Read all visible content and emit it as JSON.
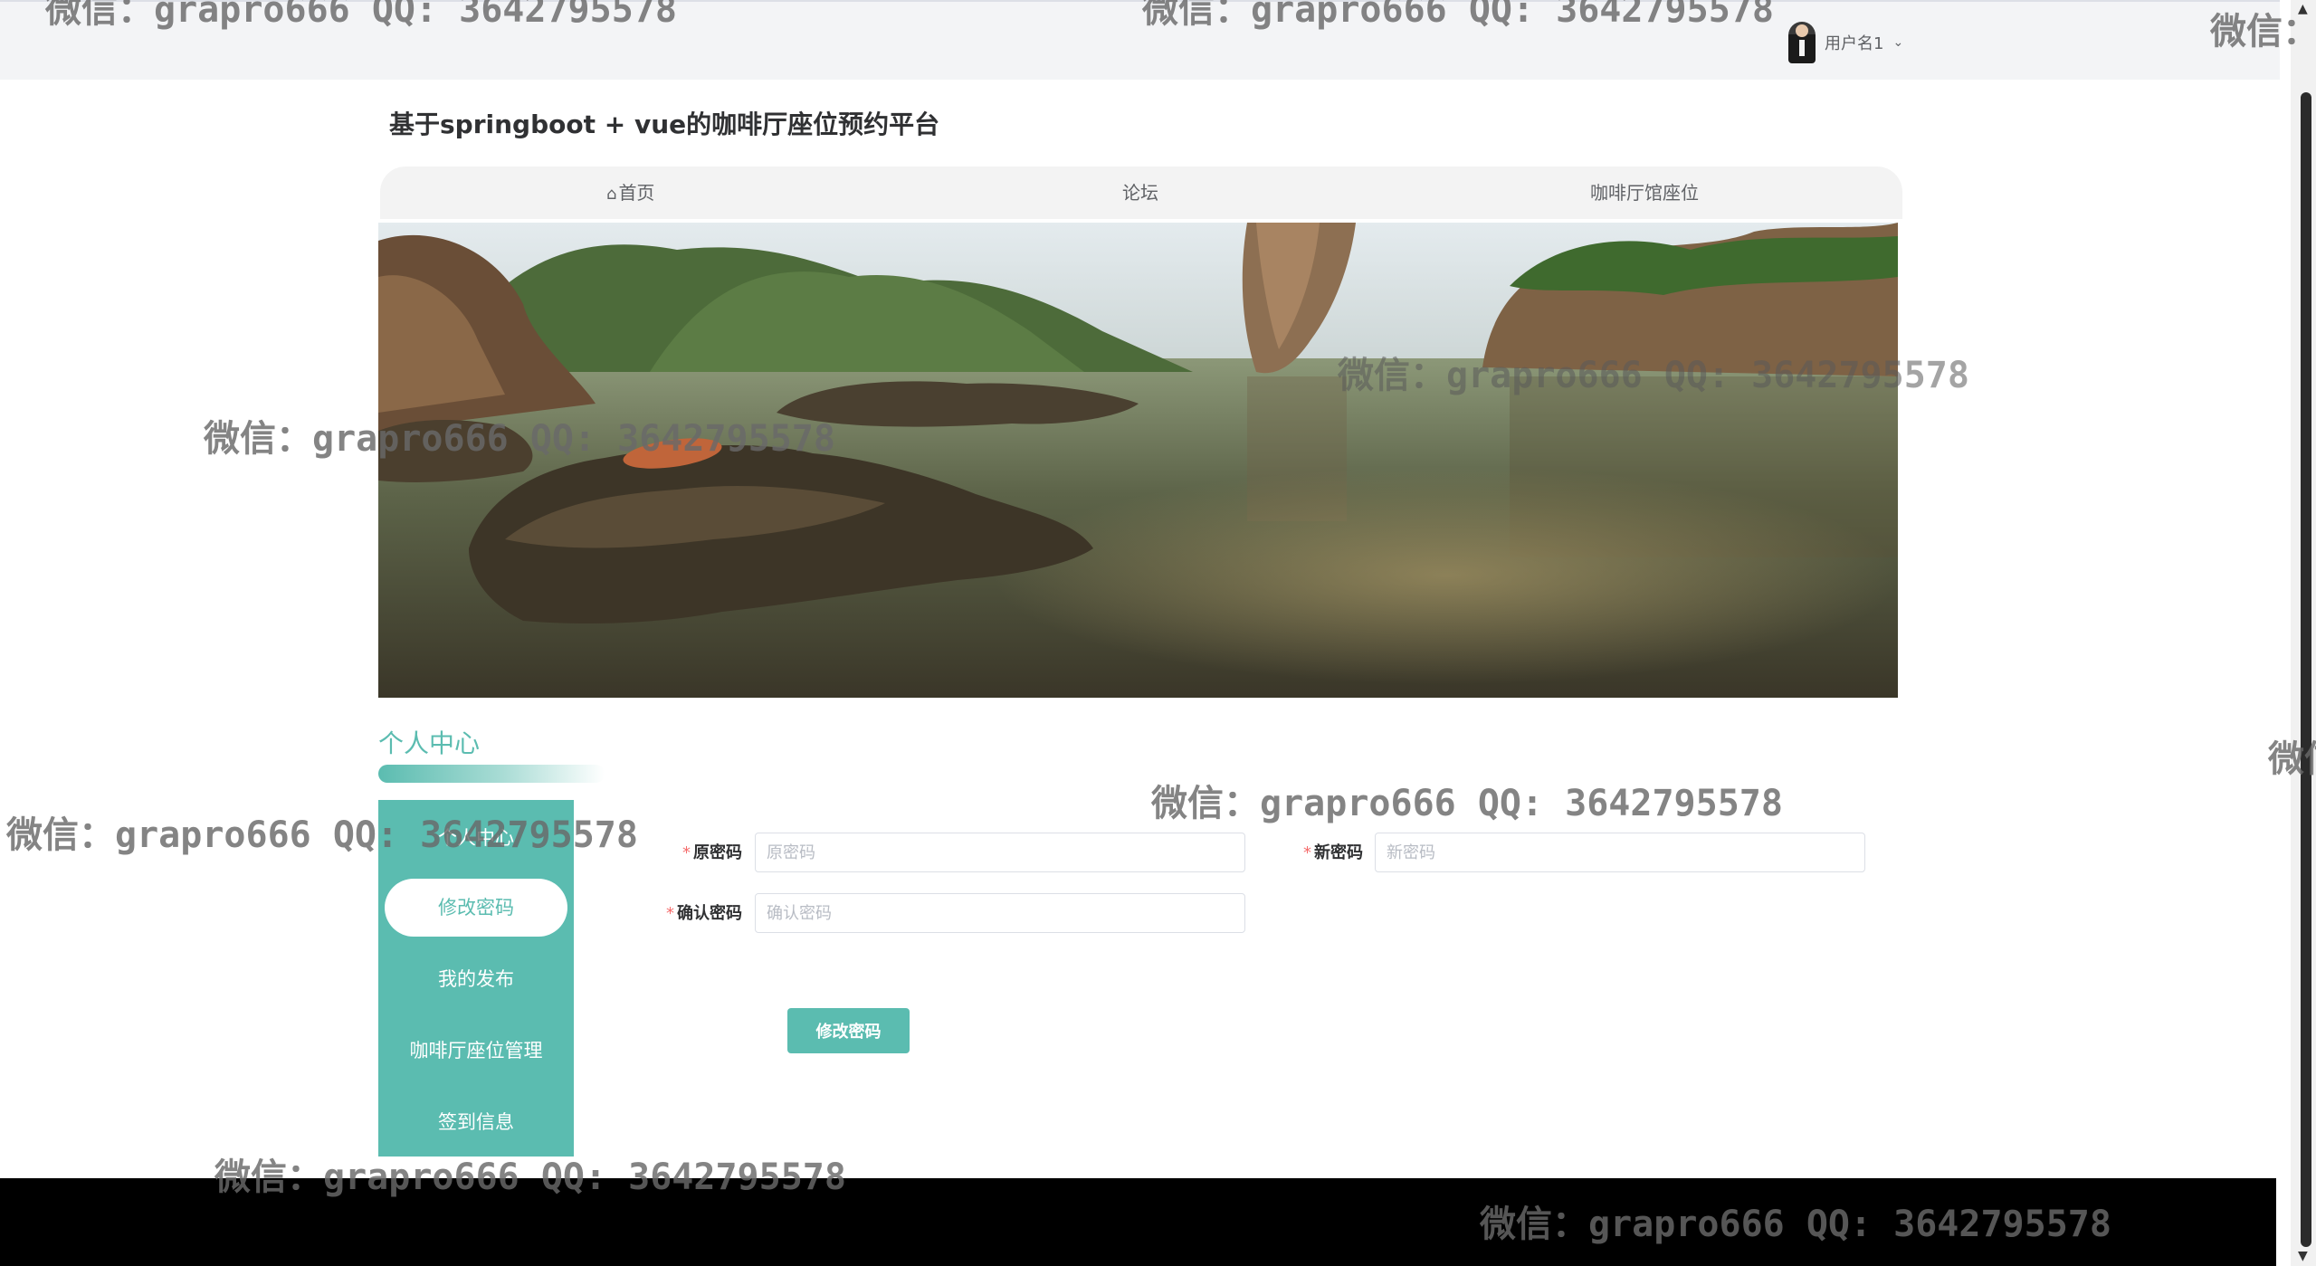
{
  "header": {
    "user_name": "用户名1",
    "dropdown_icon": "chevron-down-icon",
    "avatar_icon": "user-avatar-icon"
  },
  "site": {
    "title": "基于springboot + vue的咖啡厅座位预约平台"
  },
  "nav": {
    "items": [
      {
        "label": "首页",
        "icon": "home-icon"
      },
      {
        "label": "论坛"
      },
      {
        "label": "咖啡厅馆座位"
      }
    ]
  },
  "personal_center": {
    "title": "个人中心",
    "menu": [
      {
        "label": "个人中心",
        "active": false
      },
      {
        "label": "修改密码",
        "active": true
      },
      {
        "label": "我的发布",
        "active": false
      },
      {
        "label": "咖啡厅座位管理",
        "active": false
      },
      {
        "label": "签到信息",
        "active": false
      }
    ]
  },
  "password_form": {
    "old_password": {
      "label": "原密码",
      "placeholder": "原密码",
      "value": ""
    },
    "new_password": {
      "label": "新密码",
      "placeholder": "新密码",
      "value": ""
    },
    "confirm_password": {
      "label": "确认密码",
      "placeholder": "确认密码",
      "value": ""
    },
    "required_mark": "*",
    "submit_label": "修改密码"
  },
  "watermark": {
    "text": "微信：grapro666 QQ: 3642795578",
    "fragment": "微信："
  },
  "colors": {
    "accent": "#5bbcb0",
    "footer": "#000000",
    "topbar": "#f3f4f6"
  }
}
